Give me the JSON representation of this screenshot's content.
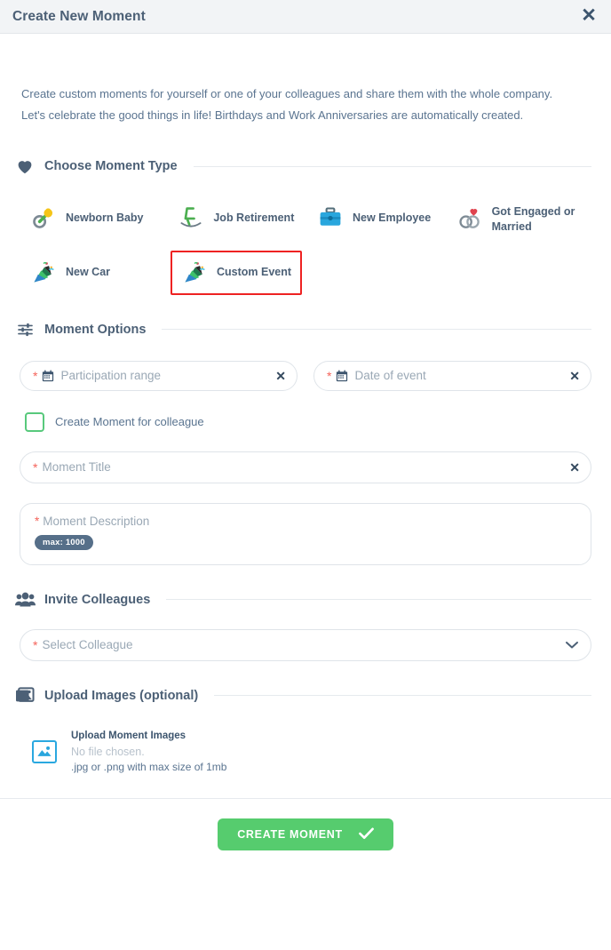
{
  "header": {
    "title": "Create New Moment",
    "close_label": "✕"
  },
  "intro": {
    "text": "Create custom moments for yourself or one of your colleagues and share them with the whole company. Let's celebrate the good things in life! Birthdays and Work Anniversaries are automatically created."
  },
  "sections": {
    "moment_type": "Choose Moment Type",
    "moment_options": "Moment Options",
    "invite_colleagues": "Invite Colleagues",
    "upload_images": "Upload Images (optional)"
  },
  "moment_types": [
    {
      "label": "Newborn Baby",
      "icon": "pacifier-icon",
      "selected": false
    },
    {
      "label": "Job Retirement",
      "icon": "rocking-chair-icon",
      "selected": false
    },
    {
      "label": "New Employee",
      "icon": "briefcase-icon",
      "selected": false
    },
    {
      "label": "Got Engaged or Married",
      "icon": "wedding-rings-icon",
      "selected": false
    },
    {
      "label": "New Car",
      "icon": "party-popper-icon",
      "selected": false
    },
    {
      "label": "Custom Event",
      "icon": "party-popper-icon",
      "selected": true
    }
  ],
  "fields": {
    "participation_range": {
      "placeholder": "Participation range",
      "value": "",
      "required": true,
      "clear_label": "✕"
    },
    "date_of_event": {
      "placeholder": "Date of event",
      "value": "",
      "required": true,
      "clear_label": "✕"
    },
    "checkbox_colleague": {
      "label": "Create Moment for colleague",
      "checked": false
    },
    "moment_title": {
      "placeholder": "Moment Title",
      "value": "",
      "required": true,
      "clear_label": "✕"
    },
    "moment_description": {
      "placeholder": "Moment Description",
      "value": "",
      "required": true,
      "max_badge": "max: 1000"
    },
    "select_colleague": {
      "placeholder": "Select Colleague",
      "value": "",
      "required": true
    }
  },
  "upload": {
    "title": "Upload Moment Images",
    "no_file": "No file chosen.",
    "hint": ".jpg or .png with max size of 1mb"
  },
  "footer": {
    "create_label": "CREATE MOMENT"
  },
  "colors": {
    "accent_green": "#56cc6e",
    "required_red": "#f4635a",
    "selection_red": "#ee2222",
    "header_text": "#4c6076",
    "body_text": "#5a7490",
    "upload_blue": "#2aa8e0"
  }
}
